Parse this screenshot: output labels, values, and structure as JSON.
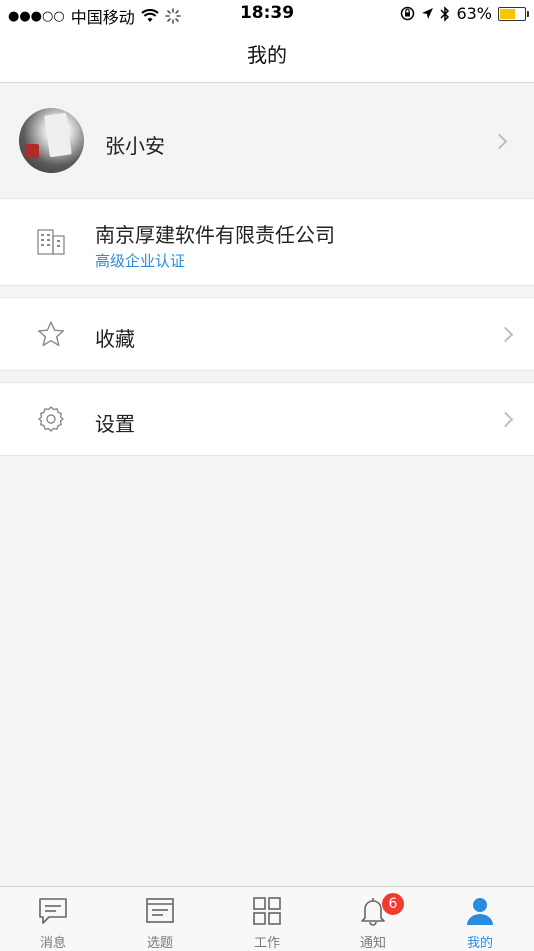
{
  "status_bar": {
    "signal": "●●●○○",
    "carrier": "中国移动",
    "time": "18:39",
    "battery_percent": "63%",
    "battery_level": 0.63
  },
  "header": {
    "title": "我的"
  },
  "profile": {
    "name": "张小安"
  },
  "company": {
    "name": "南京厚建软件有限责任公司",
    "badge": "高级企业认证"
  },
  "menu": {
    "favorites_label": "收藏",
    "settings_label": "设置"
  },
  "tab_bar": {
    "items": [
      {
        "label": "消息",
        "icon": "message-icon"
      },
      {
        "label": "选题",
        "icon": "topic-icon"
      },
      {
        "label": "工作",
        "icon": "grid-icon"
      },
      {
        "label": "通知",
        "icon": "bell-icon",
        "badge": "6"
      },
      {
        "label": "我的",
        "icon": "person-icon",
        "active": true
      }
    ]
  },
  "colors": {
    "accent": "#2a8cde",
    "badge": "#f23b30"
  }
}
